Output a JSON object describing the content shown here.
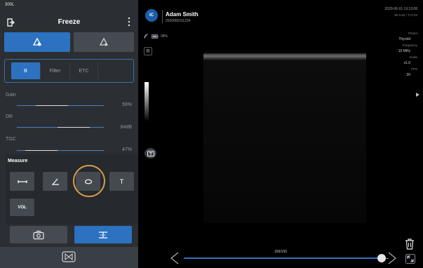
{
  "device": {
    "model": "300L"
  },
  "header": {
    "title": "Freeze"
  },
  "modes": [
    {
      "name": "conventional",
      "icon": "probe-b-icon",
      "active": true
    },
    {
      "name": "color-flow",
      "icon": "probe-cf-icon",
      "active": false
    }
  ],
  "tabs": [
    {
      "label": "B",
      "active": true
    },
    {
      "label": "Filter",
      "active": false
    },
    {
      "label": "ETC",
      "active": false
    },
    {
      "label": "",
      "active": false
    }
  ],
  "params": [
    {
      "label": "Gain",
      "value": "59%",
      "level": 0.59
    },
    {
      "label": "DR",
      "value": "84dB",
      "level": 0.84
    },
    {
      "label": "TGC",
      "value": "47%",
      "level": 0.47
    }
  ],
  "measure": {
    "title": "Measure",
    "tools": [
      {
        "name": "distance",
        "icon": "distance-icon"
      },
      {
        "name": "angle",
        "icon": "angle-icon"
      },
      {
        "name": "ellipse",
        "icon": "ellipse-icon",
        "highlighted": true
      },
      {
        "name": "text",
        "icon": "text-icon",
        "label": "T"
      }
    ],
    "vol_label": "VOL"
  },
  "bottom_buttons": [
    {
      "name": "capture",
      "icon": "camera-icon",
      "active": false
    },
    {
      "name": "caliper",
      "icon": "caliper-icon",
      "active": true
    }
  ],
  "patient": {
    "logo": "IC",
    "name": "Adam Smith",
    "id": "2020060111234"
  },
  "session": {
    "datetime": "2029-06-01 13:13:08",
    "indices": "MI 0.82 / TI 0.33"
  },
  "status": {
    "battery": "98%",
    "orientation_marker": "R"
  },
  "imaging": [
    {
      "key": "Preset",
      "value": "Thyroid"
    },
    {
      "key": "Frequency",
      "value": "10 MHz"
    },
    {
      "key": "Scale",
      "value": "x1.0"
    },
    {
      "key": "FPS",
      "value": "20"
    }
  ],
  "cine": {
    "counter": "150/150",
    "position": 1.0
  },
  "colors": {
    "accent": "#2c72c0",
    "highlight": "#d69a4a",
    "panel": "#2b2f33"
  }
}
